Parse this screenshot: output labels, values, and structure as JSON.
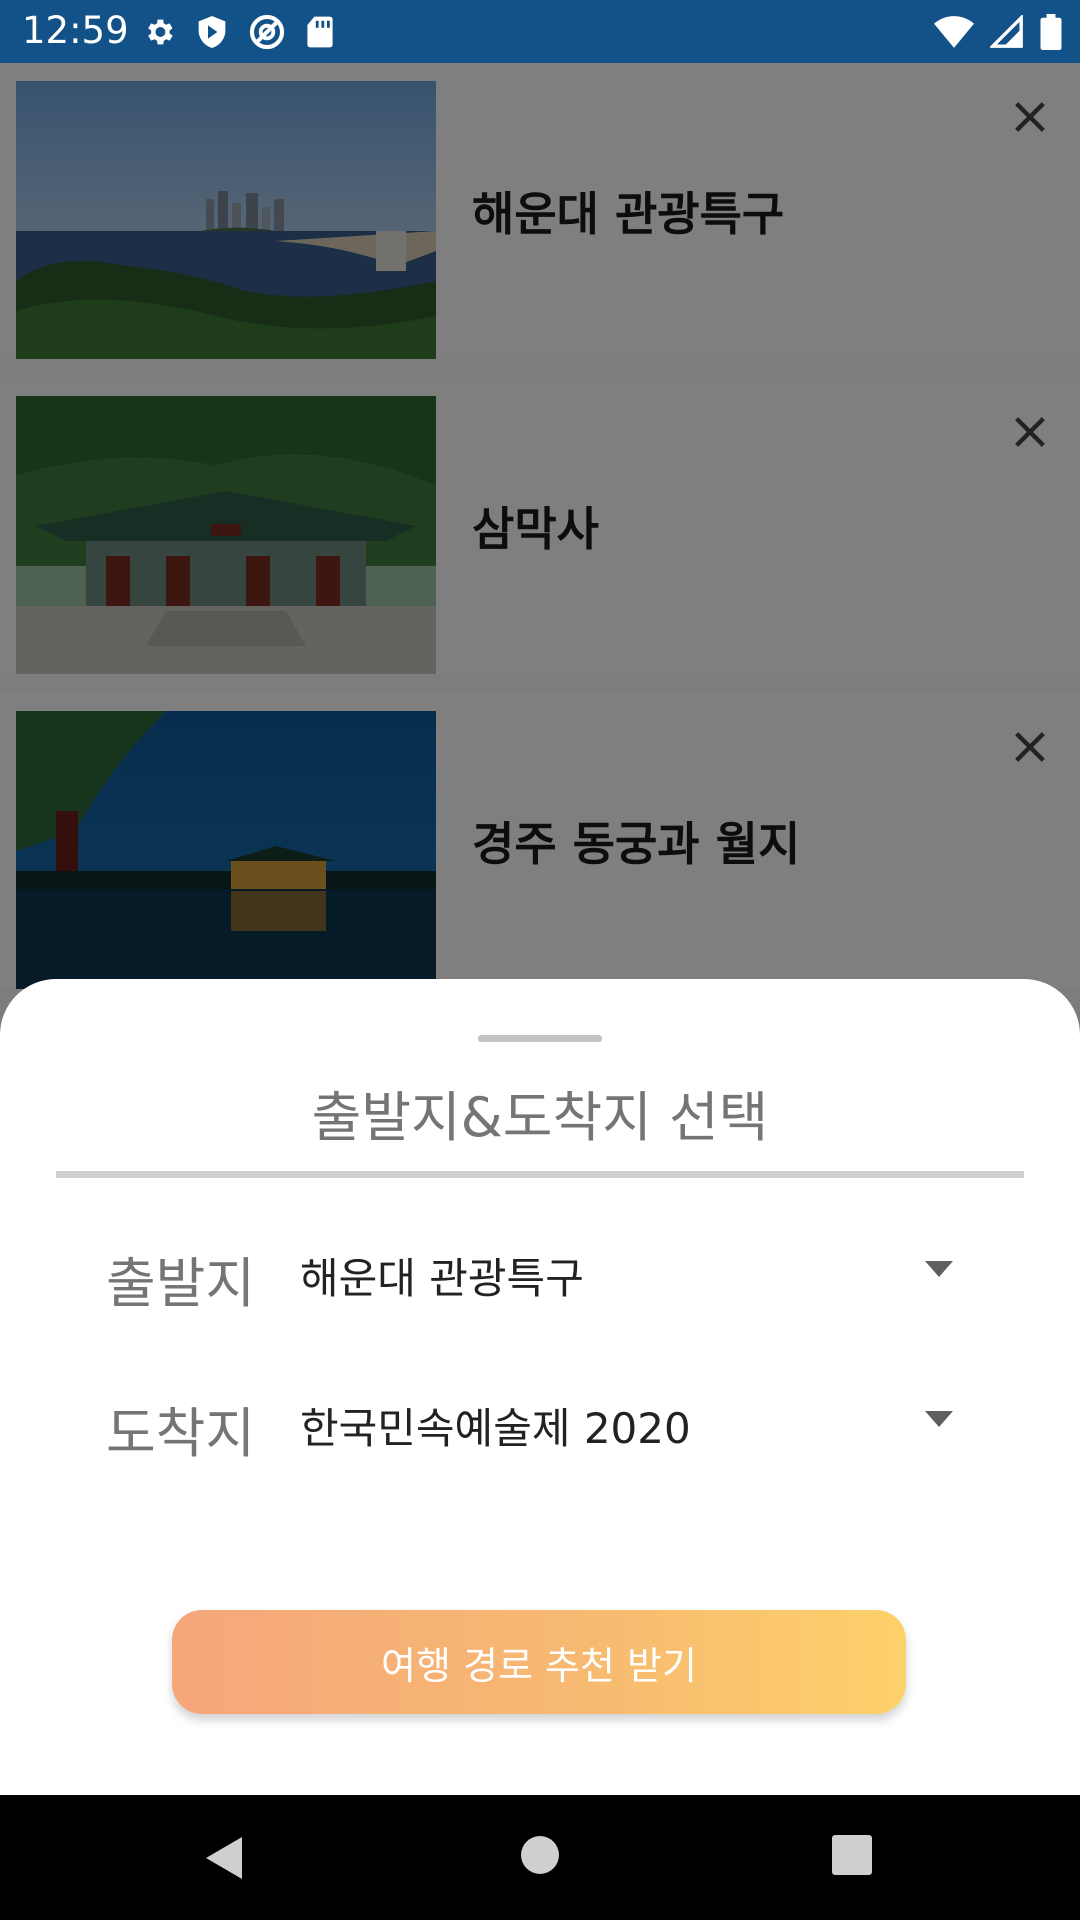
{
  "status_bar": {
    "time": "12:59",
    "left_icons": [
      "gear-icon",
      "shield-icon",
      "vpn-icon",
      "sd-card-icon"
    ],
    "right_icons": [
      "wifi-icon",
      "signal-icon",
      "battery-icon"
    ],
    "background": "#135289"
  },
  "attractions": [
    {
      "name": "해운대 관광특구",
      "image": "beach-city-image"
    },
    {
      "name": "삼막사",
      "image": "temple-image"
    },
    {
      "name": "경주 동궁과 월지",
      "image": "palace-night-image"
    }
  ],
  "sheet": {
    "title": "출발지&도착지 선택",
    "departure_label": "출발지",
    "departure_value": "해운대 관광특구",
    "arrival_label": "도착지",
    "arrival_value": "한국민속예술제 2020",
    "cta_label": "여행 경로 추천 받기",
    "cta_gradient": [
      "#f6a67b",
      "#fdd16a"
    ]
  },
  "nav_bar": {
    "buttons": [
      "back-icon",
      "home-icon",
      "recents-icon"
    ]
  }
}
